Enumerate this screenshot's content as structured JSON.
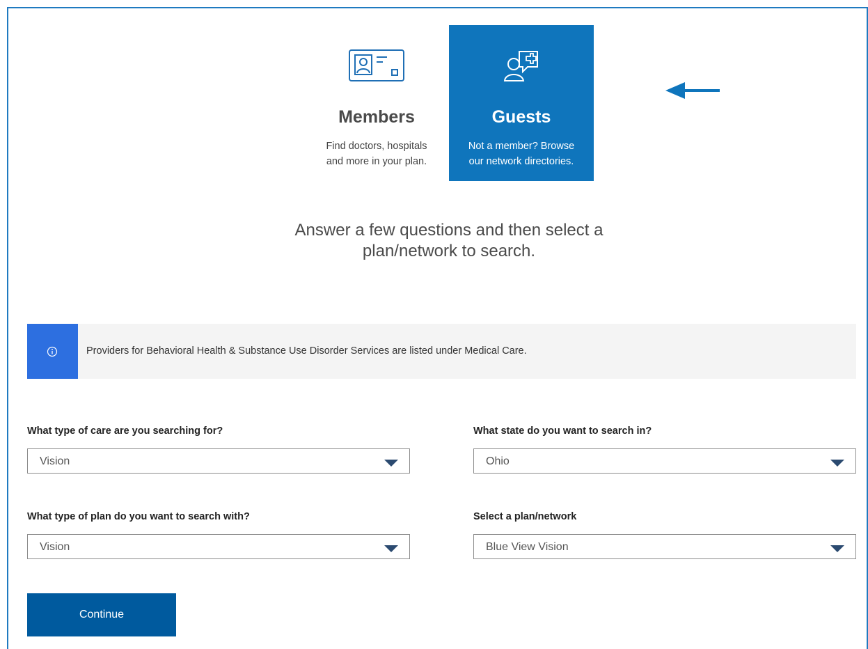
{
  "tabs": {
    "members": {
      "title": "Members",
      "desc_line1": "Find doctors, hospitals",
      "desc_line2": "and more in your plan.",
      "icon": "member-id-card-icon"
    },
    "guests": {
      "title": "Guests",
      "desc_line1": "Not a member? Browse",
      "desc_line2": "our network directories.",
      "icon": "guest-medical-chat-icon",
      "selected": true
    }
  },
  "headline": {
    "line1": "Answer a few questions and then select a",
    "line2": "plan/network to search."
  },
  "banner": {
    "icon": "info-icon",
    "text": "Providers for Behavioral Health & Substance Use Disorder Services are listed under Medical Care."
  },
  "form": {
    "care_type": {
      "label": "What type of care are you searching for?",
      "value": "Vision"
    },
    "state": {
      "label": "What state do you want to search in?",
      "value": "Ohio"
    },
    "plan_type": {
      "label": "What type of plan do you want to search with?",
      "value": "Vision"
    },
    "plan_network": {
      "label": "Select a plan/network",
      "value": "Blue View Vision"
    }
  },
  "continue_label": "Continue",
  "colors": {
    "primary": "#0f75bc",
    "button": "#005a9e",
    "info": "#2d6fe0",
    "banner_bg": "#f4f4f4"
  }
}
